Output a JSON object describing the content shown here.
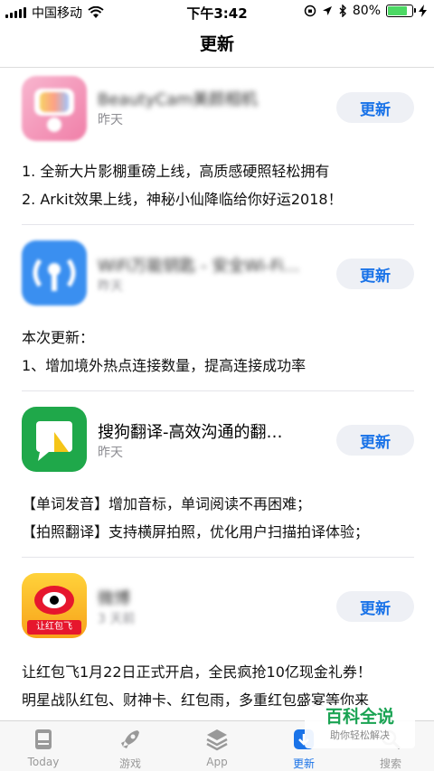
{
  "status_bar": {
    "carrier": "中国移动",
    "time": "下午3:42",
    "battery": "80%",
    "battery_level": 0.8
  },
  "nav": {
    "title": "更新"
  },
  "entries": [
    {
      "name": "BeautyCam美颜相机",
      "date": "昨天",
      "button": "更新",
      "notes": [
        "1. 全新大片影棚重磅上线，高质感硬照轻松拥有",
        "2. Arkit效果上线，神秘小仙降临给你好运2018！"
      ]
    },
    {
      "name": "WiFi万能钥匙 - 安全Wi-Fi…",
      "date": "昨天",
      "button": "更新",
      "notes": [
        "本次更新：",
        "1、增加境外热点连接数量，提高连接成功率"
      ]
    },
    {
      "name": "搜狗翻译-高效沟通的翻…",
      "date": "昨天",
      "button": "更新",
      "notes": [
        "【单词发音】增加音标，单词阅读不再困难；",
        "【拍照翻译】支持横屏拍照，优化用户扫描拍译体验；"
      ]
    },
    {
      "name": "微博",
      "date": "3 天前",
      "button": "更新",
      "icon_text": "让红包飞",
      "notes": [
        "让红包飞1月22日正式开启，全民疯抢10亿现金礼券！",
        "明星战队红包、财神卡、红包雨，多重红包盛宴等你来"
      ]
    }
  ],
  "tabs": [
    {
      "label": "Today",
      "icon": "today-icon"
    },
    {
      "label": "游戏",
      "icon": "rocket-icon"
    },
    {
      "label": "App",
      "icon": "layers-icon"
    },
    {
      "label": "更新",
      "icon": "updates-icon"
    },
    {
      "label": "搜索",
      "icon": "search-icon"
    }
  ],
  "watermark": {
    "main": "百科全说",
    "sub": "助你轻松解决"
  },
  "colors": {
    "accent": "#1a73e8",
    "button_bg": "#eef0f5",
    "watermark_green": "#1aa353"
  }
}
